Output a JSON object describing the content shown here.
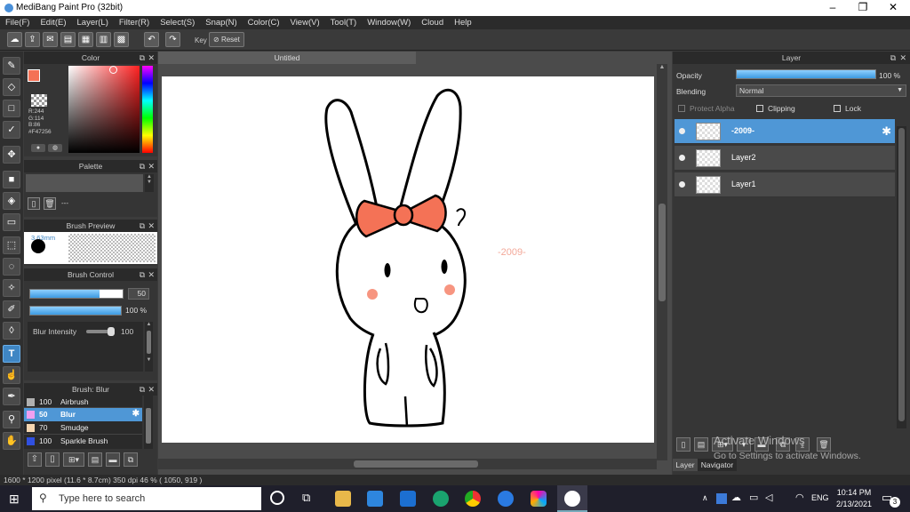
{
  "window": {
    "title": "MediBang Paint Pro (32bit)",
    "minimize": "–",
    "maximize": "❐",
    "close": "✕"
  },
  "menu": [
    "File(F)",
    "Edit(E)",
    "Layer(L)",
    "Filter(R)",
    "Select(S)",
    "Snap(N)",
    "Color(C)",
    "View(V)",
    "Tool(T)",
    "Window(W)",
    "Cloud",
    "Help"
  ],
  "toolbar": {
    "key_label": "Key",
    "reset_label": "Reset"
  },
  "color_panel": {
    "title": "Color",
    "r": "R:244",
    "g": "G:114",
    "b": "B:86",
    "hex": "#F47256",
    "primary": "#F47256"
  },
  "palette_panel": {
    "title": "Palette",
    "dash": "---"
  },
  "brush_preview": {
    "title": "Brush Preview",
    "size": "3.63mm"
  },
  "brush_control": {
    "title": "Brush Control",
    "size_value": "50",
    "size_fill": 0.75,
    "opacity_value": "100 %",
    "opacity_fill": 1.0,
    "blur_label": "Blur Intensity",
    "blur_value": "100"
  },
  "brush_list": {
    "title": "Brush: Blur",
    "items": [
      {
        "size": "100",
        "name": "Airbrush",
        "color": "#b0b0b0"
      },
      {
        "size": "50",
        "name": "Blur",
        "color": "#f0a0f0"
      },
      {
        "size": "70",
        "name": "Smudge",
        "color": "#f5d6b0"
      },
      {
        "size": "100",
        "name": "Sparkle Brush",
        "color": "#3050e0"
      }
    ]
  },
  "canvas": {
    "doc_title": "Untitled",
    "watermark": "-2009-"
  },
  "layer_panel": {
    "title": "Layer",
    "opacity_label": "Opacity",
    "opacity_value": "100 %",
    "blending_label": "Blending",
    "blending_value": "Normal",
    "protect_alpha": "Protect Alpha",
    "clipping": "Clipping",
    "lock": "Lock",
    "layers": [
      {
        "name": "-2009-",
        "selected": true
      },
      {
        "name": "Layer2",
        "selected": false
      },
      {
        "name": "Layer1",
        "selected": false
      }
    ],
    "tab_layer": "Layer",
    "tab_navigator": "Navigator",
    "activate_line1": "Activate Windows",
    "activate_line2": "Go to Settings to activate Windows."
  },
  "status": {
    "text": "1600 * 1200 pixel   (11.6 * 8.7cm)   350 dpi   46 %   ( 1050, 919 )"
  },
  "taskbar": {
    "search_placeholder": "Type here to search",
    "lang": "ENG",
    "time": "10:14 PM",
    "date": "2/13/2021",
    "notif_count": "3"
  }
}
